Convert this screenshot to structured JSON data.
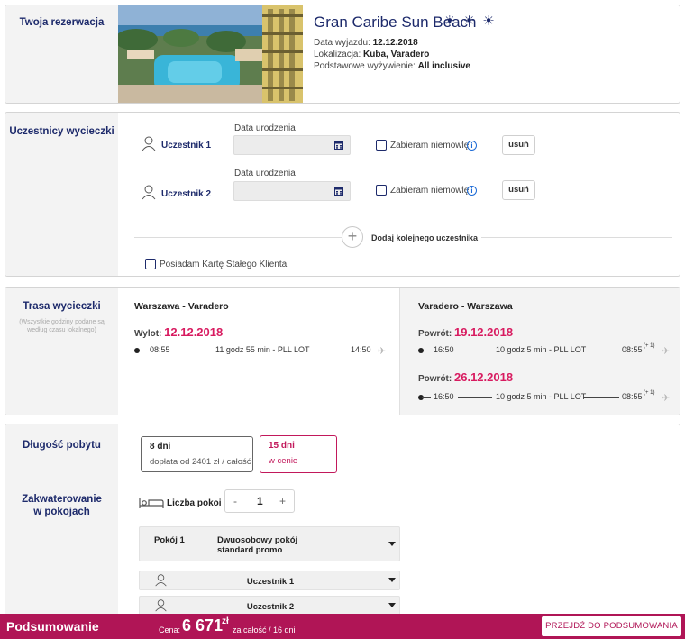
{
  "reservation": {
    "section_title": "Twoja rezerwacja",
    "hotel_name": "Gran Caribe Sun Beach",
    "stars": "☀ ☀ ☀",
    "departure_label": "Data wyjazdu:",
    "departure_value": "12.12.2018",
    "location_label": "Lokalizacja:",
    "location_value": "Kuba, Varadero",
    "board_label": "Podstawowe wyżywienie:",
    "board_value": "All inclusive"
  },
  "participants": {
    "section_title": "Uczestnicy wycieczki",
    "items": [
      {
        "name": "Uczestnik 1",
        "dob_label": "Data urodzenia",
        "dob_value": "",
        "infant_label": "Zabieram niemowlę",
        "remove_label": "usuń"
      },
      {
        "name": "Uczestnik 2",
        "dob_label": "Data urodzenia",
        "dob_value": "",
        "infant_label": "Zabieram niemowlę",
        "remove_label": "usuń"
      }
    ],
    "add_label": "Dodaj kolejnego uczestnika",
    "loyalty_label": "Posiadam Kartę Stałego Klienta"
  },
  "route": {
    "section_title": "Trasa wycieczki",
    "note": "(Wszystkie godziny podane są według czasu lokalnego)",
    "outbound": {
      "header": "Warszawa - Varadero",
      "label": "Wylot:",
      "date": "12.12.2018",
      "dep": "08:55",
      "info": "11 godz 55 min - PLL LOT",
      "arr": "14:50"
    },
    "return": {
      "header": "Varadero - Warszawa",
      "flights": [
        {
          "label": "Powrót:",
          "date": "19.12.2018",
          "dep": "16:50",
          "info": "10 godz 5 min - PLL LOT",
          "arr": "08:55",
          "offset": "(+ 1)"
        },
        {
          "label": "Powrót:",
          "date": "26.12.2018",
          "dep": "16:50",
          "info": "10 godz 5 min - PLL LOT",
          "arr": "08:55",
          "offset": "(+ 1)"
        }
      ]
    }
  },
  "stay": {
    "section_title": "Długość pobytu",
    "options": [
      {
        "days": "8 dni",
        "price": "dopłata od 2401 zł / całość",
        "selected": false
      },
      {
        "days": "15 dni",
        "price": "w cenie",
        "selected": true
      }
    ]
  },
  "accommodation": {
    "section_title": "Zakwaterowanie w pokojach",
    "rooms_label": "Liczba pokoi",
    "rooms_count": "1",
    "minus": "-",
    "plus": "+",
    "room_label": "Pokój 1",
    "room_type": "Dwuosobowy pokój standard promo",
    "occupants": [
      "Uczestnik 1",
      "Uczestnik 2"
    ]
  },
  "summary_bar": {
    "title": "Podsumowanie",
    "price_label": "Cena:",
    "price": "6 671",
    "currency": "zł",
    "suffix": "za całość / 16 dni",
    "button": "PRZEJDŹ DO PODSUMOWANIA"
  },
  "colors": {
    "navy": "#1d2a6b",
    "accent": "#d81b60",
    "bar": "#b01556"
  }
}
